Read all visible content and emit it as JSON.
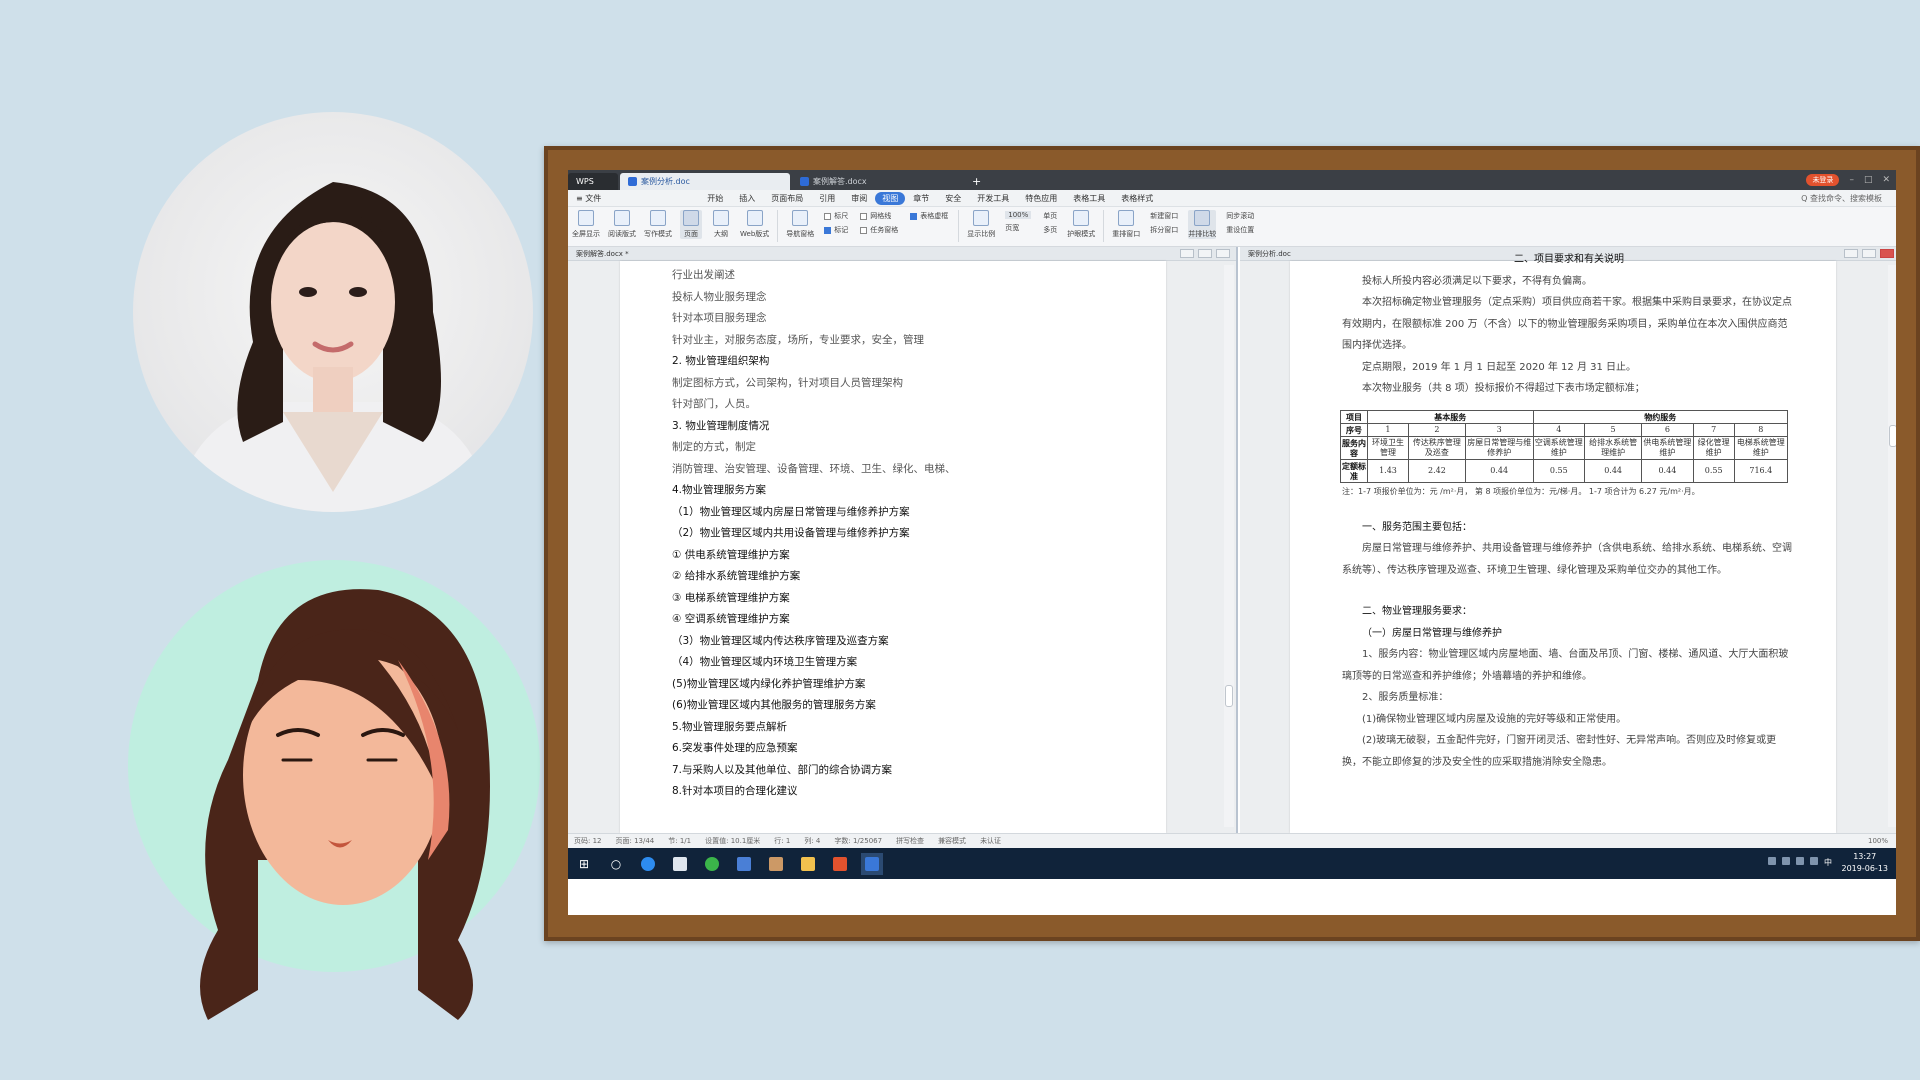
{
  "app": {
    "wps_label": "WPS",
    "tabs": [
      {
        "label": "案例分析.doc"
      },
      {
        "label": "案例解答.docx"
      }
    ],
    "new_tab": "+",
    "login_button": "未登录"
  },
  "menu": {
    "file": "≡ 文件",
    "items": [
      "开始",
      "插入",
      "页面布局",
      "引用",
      "审阅",
      "视图",
      "章节",
      "安全",
      "开发工具",
      "特色应用",
      "表格工具",
      "表格样式"
    ],
    "selected": "视图",
    "search": "Q 查找命令、搜索模板"
  },
  "ribbon": {
    "buttons": [
      "全屏显示",
      "阅读版式",
      "写作模式",
      "页面",
      "大纲",
      "Web版式"
    ],
    "nav": "导航窗格",
    "checks": [
      {
        "label": "标尺",
        "checked": false
      },
      {
        "label": "网格线",
        "checked": false
      },
      {
        "label": "表格虚框",
        "checked": true
      },
      {
        "label": "标记",
        "checked": true
      },
      {
        "label": "任务窗格",
        "checked": false
      }
    ],
    "zoom_buttons": [
      "显示比例",
      "100%",
      "单页",
      "页宽",
      "多页"
    ],
    "eye": "护眼模式",
    "window_buttons": [
      "重排窗口",
      "新建窗口",
      "拆分窗口",
      "并排比较",
      "同步滚动",
      "重设位置"
    ]
  },
  "left_doc": {
    "title": "案例解答.docx *",
    "lines": [
      {
        "text": "行业出发阐述",
        "bold": false
      },
      {
        "text": "投标人物业服务理念",
        "bold": false
      },
      {
        "text": "针对本项目服务理念",
        "bold": false
      },
      {
        "text": "针对业主，对服务态度，场所，专业要求，安全，管理",
        "bold": false
      },
      {
        "text": "2. 物业管理组织架构",
        "bold": true
      },
      {
        "text": "制定图标方式，公司架构，针对项目人员管理架构",
        "bold": false
      },
      {
        "text": "针对部门，人员。",
        "bold": false
      },
      {
        "text": "3. 物业管理制度情况",
        "bold": true
      },
      {
        "text": "制定的方式，制定",
        "bold": false
      },
      {
        "text": "消防管理、治安管理、设备管理、环境、卫生、绿化、电梯、",
        "bold": false
      },
      {
        "text": "4.物业管理服务方案",
        "bold": true
      },
      {
        "text": "（1）物业管理区域内房屋日常管理与维修养护方案",
        "bold": true
      },
      {
        "text": "（2）物业管理区域内共用设备管理与维修养护方案",
        "bold": true
      },
      {
        "text": "①  供电系统管理维护方案",
        "bold": true
      },
      {
        "text": "②  给排水系统管理维护方案",
        "bold": true
      },
      {
        "text": "③  电梯系统管理维护方案",
        "bold": true
      },
      {
        "text": "④  空调系统管理维护方案",
        "bold": true
      },
      {
        "text": "（3）物业管理区域内传达秩序管理及巡查方案",
        "bold": true
      },
      {
        "text": "（4）物业管理区域内环境卫生管理方案",
        "bold": true
      },
      {
        "text": "(5)物业管理区域内绿化养护管理维护方案",
        "bold": true
      },
      {
        "text": "(6)物业管理区域内其他服务的管理服务方案",
        "bold": true
      },
      {
        "text": "5.物业管理服务要点解析",
        "bold": true
      },
      {
        "text": "6.突发事件处理的应急预案",
        "bold": true
      },
      {
        "text": "7.与采购人以及其他单位、部门的综合协调方案",
        "bold": true
      },
      {
        "text": "8.针对本项目的合理化建议",
        "bold": true
      }
    ]
  },
  "right_doc": {
    "title": "案例分析.doc",
    "heading": "二、项目要求和有关说明",
    "paras": [
      "投标人所投内容必须满足以下要求，不得有负偏离。",
      "本次招标确定物业管理服务（定点采购）项目供应商若干家。根据集中采购目录要求，在协议定点有效期内，在限额标准 200 万（不含）以下的物业管理服务采购项目，采购单位在本次入围供应商范围内择优选择。",
      "定点期限，2019 年 1 月 1 日起至 2020 年 12 月 31 日止。",
      "本次物业服务（共 8 项）投标报价不得超过下表市场定额标准；"
    ],
    "table": {
      "row1": [
        "项目",
        "基本服务",
        "物约服务"
      ],
      "row2_label": "序号",
      "nums": [
        "1",
        "2",
        "3",
        "4",
        "5",
        "6",
        "7",
        "8"
      ],
      "row3_label": "服务内容",
      "items": [
        "环境卫生管理",
        "传达秩序管理及巡查",
        "房屋日常管理与维修养护",
        "空调系统管理维护",
        "给排水系统管理维护",
        "供电系统管理维护",
        "绿化管理维护",
        "电梯系统管理维护"
      ],
      "row4_label": "定额标准",
      "values": [
        "1.43",
        "2.42",
        "0.44",
        "0.55",
        "0.44",
        "0.44",
        "0.55",
        "716.4"
      ]
    },
    "note": "注：1-7 项报价单位为：元 /m²·月，  第 8 项报价单位为：元/梯·月。  1-7 项合计为 6.27 元/m²·月。",
    "sec1": "一、服务范围主要包括：",
    "sec1_text": "房屋日常管理与维修养护、共用设备管理与维修养护（含供电系统、给排水系统、电梯系统、空调系统等）、传达秩序管理及巡查、环境卫生管理、绿化管理及采购单位交办的其他工作。",
    "sec2": "二、物业管理服务要求：",
    "sec2_sub": "（一）房屋日常管理与维修养护",
    "items2": [
      "1、服务内容：物业管理区域内房屋地面、墙、台面及吊顶、门窗、楼梯、通风道、大厅大面积玻璃顶等的日常巡查和养护维修；外墙幕墙的养护和维修。",
      "2、服务质量标准：",
      "(1)确保物业管理区域内房屋及设施的完好等级和正常使用。",
      "(2)玻璃无破裂，五金配件完好，门窗开闭灵活、密封性好、无异常声响。否则应及时修复或更换，不能立即修复的涉及安全性的应采取措施消除安全隐患。"
    ]
  },
  "status": {
    "items": [
      "页码: 12",
      "页面: 13/44",
      "节: 1/1",
      "设置值: 10.1厘米",
      "行: 1",
      "列: 4",
      "字数: 1/25067",
      "拼写检查",
      "兼容模式",
      "未认证"
    ],
    "zoom": "100%"
  },
  "taskbar": {
    "time": "13:27",
    "date": "2019-06-13",
    "ime": "中"
  }
}
